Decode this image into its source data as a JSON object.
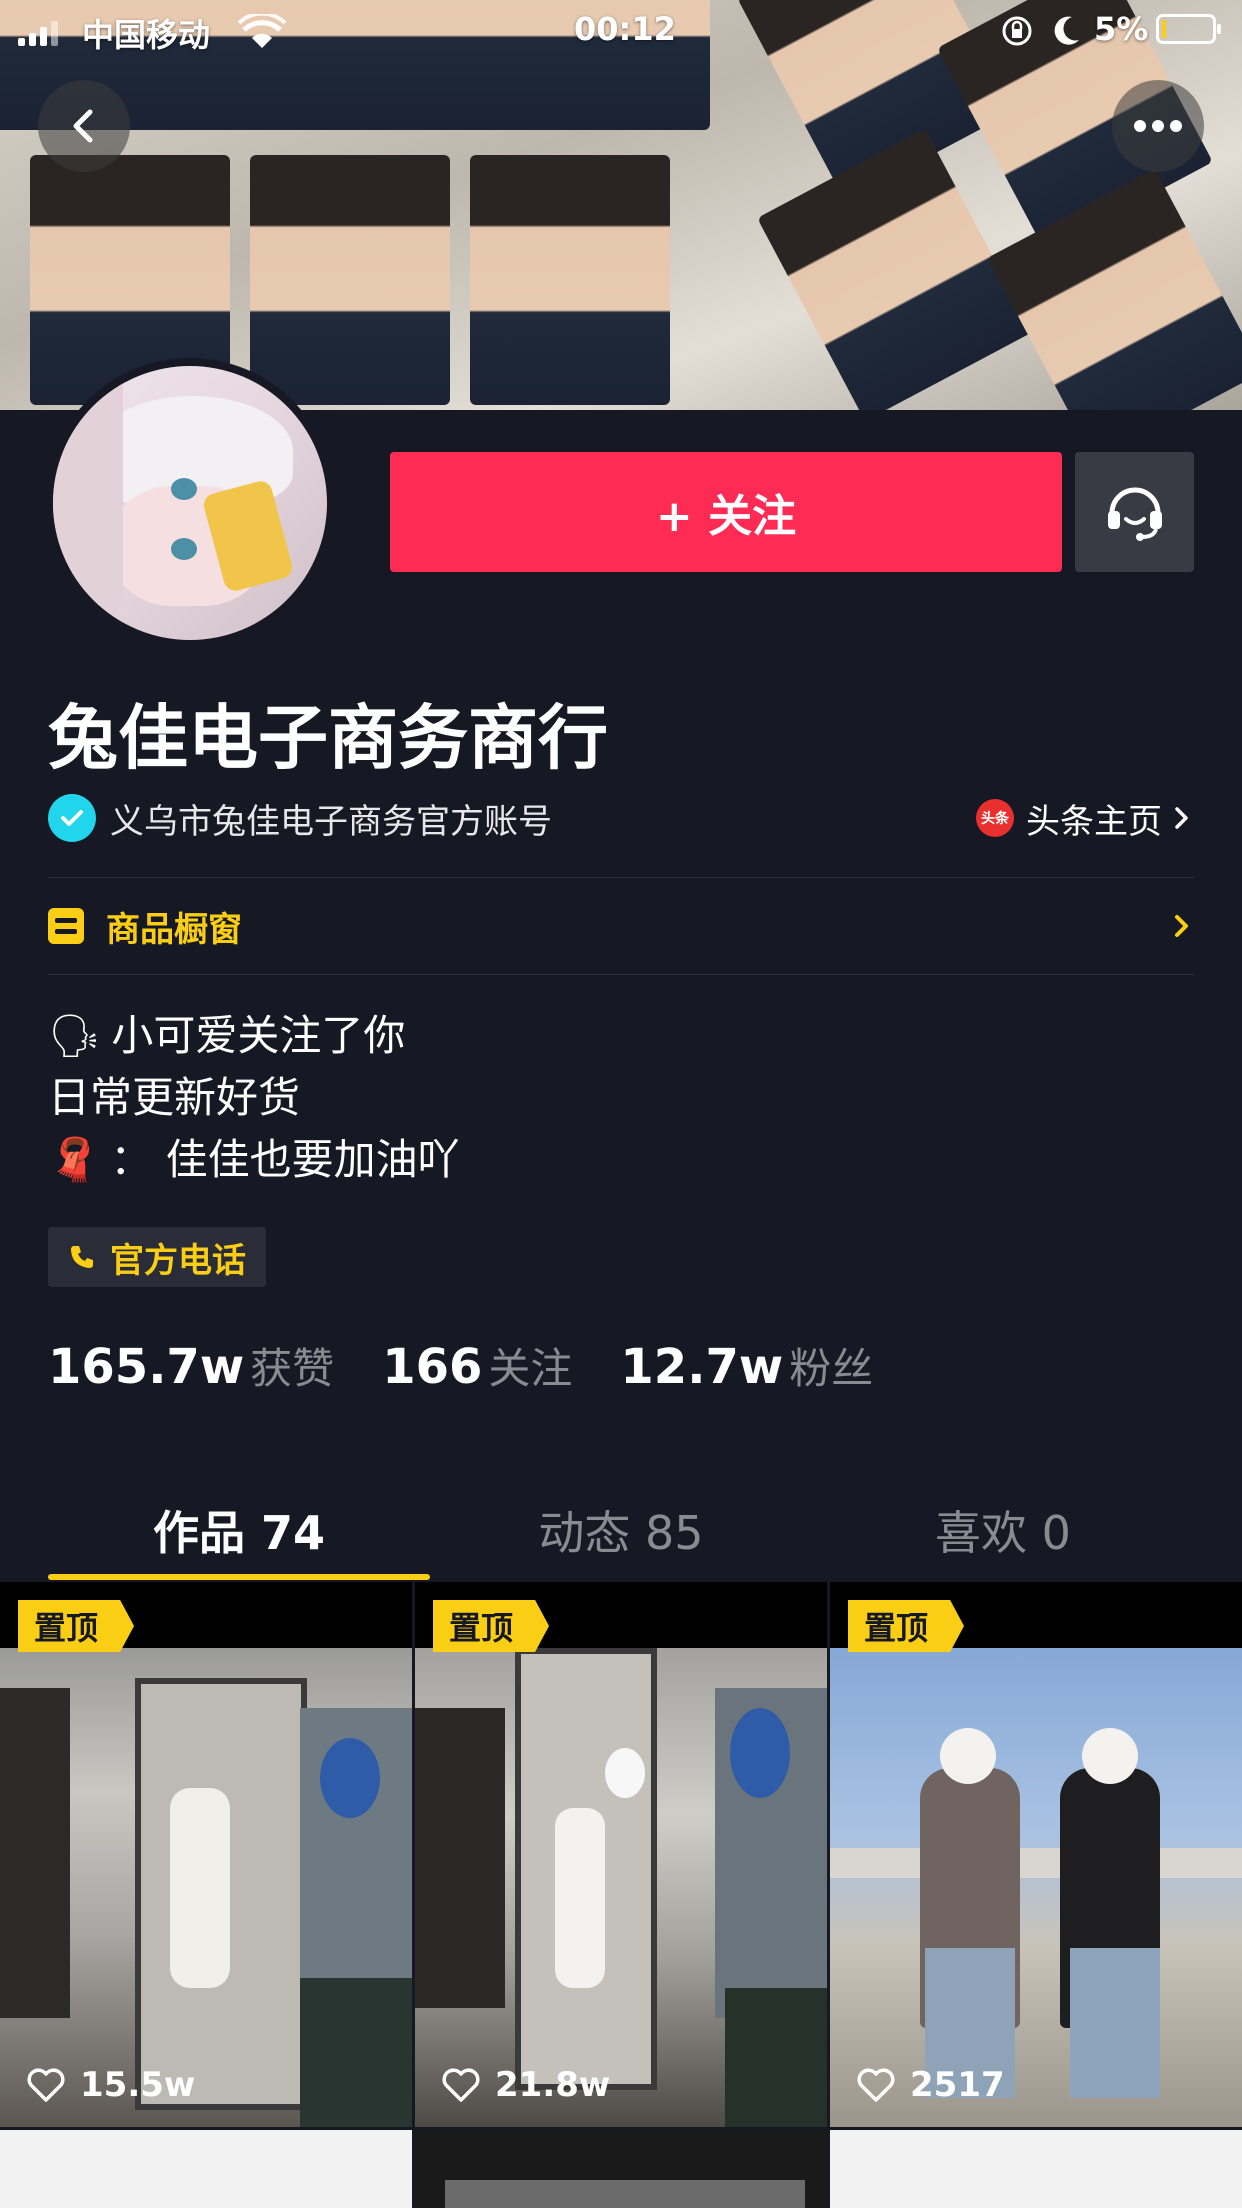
{
  "status_bar": {
    "carrier": "中国移动",
    "time": "00:12",
    "battery": "5%"
  },
  "profile": {
    "follow_label": "+ 关注",
    "name": "兔佳电子商务商行",
    "verified_text": "义乌市兔佳电子商务官方账号",
    "toutiao_icon_text": "头条",
    "toutiao_label": "头条主页",
    "showcase_label": "商品橱窗",
    "bio": {
      "line1_emoji": "🗣",
      "line1": "小可爱关注了你",
      "line2": "日常更新好货",
      "line3_emoji": "🧣",
      "line3": "：  佳佳也要加油吖"
    },
    "phone_label": "官方电话"
  },
  "stats": {
    "likes_value": "165.7w",
    "likes_label": "获赞",
    "following_value": "166",
    "following_label": "关注",
    "fans_value": "12.7w",
    "fans_label": "粉丝"
  },
  "tabs": [
    {
      "label": "作品 74",
      "active": true
    },
    {
      "label": "动态 85",
      "active": false
    },
    {
      "label": "喜欢 0",
      "active": false
    }
  ],
  "videos": [
    {
      "pin": "置顶",
      "likes": "15.5w"
    },
    {
      "pin": "置顶",
      "likes": "21.8w"
    },
    {
      "pin": "置顶",
      "likes": "2517"
    }
  ],
  "colors": {
    "background": "#161823",
    "follow": "#fe2c55",
    "accent": "#face15",
    "verified": "#20d5ec"
  },
  "icons": {
    "back": "chevron-left-icon",
    "more": "more-dots-icon",
    "chat": "headset-icon",
    "verified": "check-badge-icon",
    "showcase": "shop-icon",
    "phone": "phone-icon",
    "like": "heart-icon"
  }
}
